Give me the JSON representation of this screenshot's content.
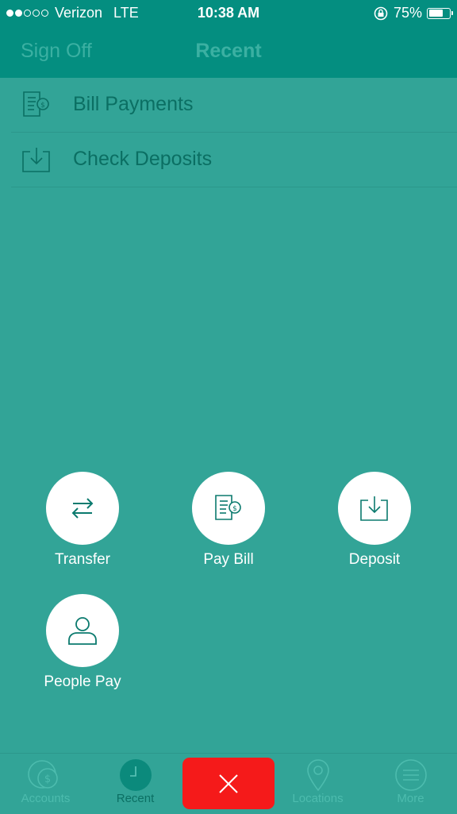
{
  "status_bar": {
    "carrier": "Verizon",
    "network": "LTE",
    "time": "10:38 AM",
    "battery": "75%",
    "battery_level": 0.75,
    "signal_bars_filled": 2,
    "signal_bars_total": 5
  },
  "nav": {
    "left_button": "Sign Off",
    "title": "Recent"
  },
  "menu": {
    "items": [
      {
        "label": "Bill Payments",
        "icon": "bill-icon"
      },
      {
        "label": "Check Deposits",
        "icon": "deposit-tray-icon"
      }
    ]
  },
  "actions": [
    {
      "label": "Transfer",
      "icon": "transfer-arrows-icon"
    },
    {
      "label": "Pay Bill",
      "icon": "bill-icon"
    },
    {
      "label": "Deposit",
      "icon": "deposit-tray-icon"
    },
    {
      "label": "People Pay",
      "icon": "person-icon"
    }
  ],
  "tabs": [
    {
      "label": "Accounts",
      "icon": "accounts-coin-icon",
      "active": false
    },
    {
      "label": "Recent",
      "icon": "clock-icon",
      "active": true
    },
    {
      "label": "Locations",
      "icon": "location-pin-icon",
      "active": false
    },
    {
      "label": "More",
      "icon": "menu-lines-icon",
      "active": false
    }
  ],
  "close_button": {
    "icon": "close-icon"
  },
  "colors": {
    "background": "#32a497",
    "header": "#048e80",
    "close_button": "#f51a1a",
    "text_dark": "#0b6f63"
  }
}
